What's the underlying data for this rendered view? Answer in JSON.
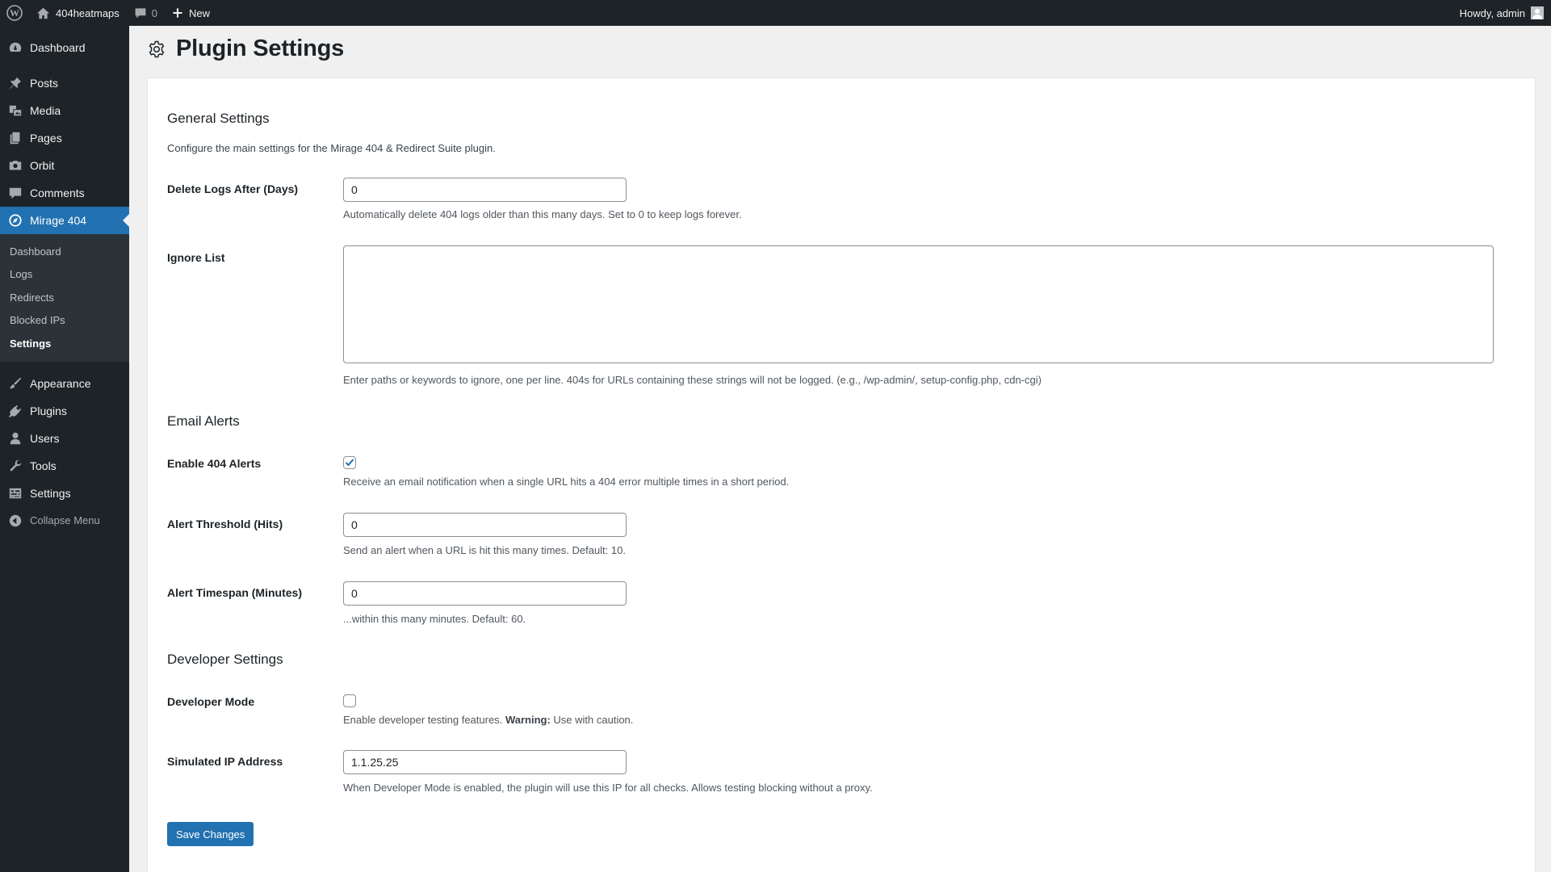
{
  "admin_bar": {
    "site_name": "404heatmaps",
    "comments_count": "0",
    "new_label": "New",
    "howdy": "Howdy, admin"
  },
  "sidebar": {
    "dashboard": "Dashboard",
    "posts": "Posts",
    "media": "Media",
    "pages": "Pages",
    "orbit": "Orbit",
    "comments": "Comments",
    "mirage": "Mirage 404",
    "submenu": [
      "Dashboard",
      "Logs",
      "Redirects",
      "Blocked IPs",
      "Settings"
    ],
    "appearance": "Appearance",
    "plugins": "Plugins",
    "users": "Users",
    "tools": "Tools",
    "settings": "Settings",
    "collapse": "Collapse Menu"
  },
  "page": {
    "title": "Plugin Settings"
  },
  "general": {
    "heading": "General Settings",
    "description": "Configure the main settings for the Mirage 404 & Redirect Suite plugin.",
    "delete_logs_label": "Delete Logs After (Days)",
    "delete_logs_value": "0",
    "delete_logs_help": "Automatically delete 404 logs older than this many days. Set to 0 to keep logs forever.",
    "ignore_list_label": "Ignore List",
    "ignore_list_value": "",
    "ignore_list_help": "Enter paths or keywords to ignore, one per line. 404s for URLs containing these strings will not be logged. (e.g., /wp-admin/, setup-config.php, cdn-cgi)"
  },
  "email": {
    "heading": "Email Alerts",
    "enable_label": "Enable 404 Alerts",
    "enable_checked": true,
    "enable_help": "Receive an email notification when a single URL hits a 404 error multiple times in a short period.",
    "threshold_label": "Alert Threshold (Hits)",
    "threshold_value": "0",
    "threshold_help": "Send an alert when a URL is hit this many times. Default: 10.",
    "timespan_label": "Alert Timespan (Minutes)",
    "timespan_value": "0",
    "timespan_help": "...within this many minutes. Default: 60."
  },
  "developer": {
    "heading": "Developer Settings",
    "mode_label": "Developer Mode",
    "mode_checked": false,
    "mode_help_prefix": "Enable developer testing features.",
    "mode_help_warning": "Warning:",
    "mode_help_suffix": "Use with caution.",
    "ip_label": "Simulated IP Address",
    "ip_value": "1.1.25.25",
    "ip_help": "When Developer Mode is enabled, the plugin will use this IP for all checks. Allows testing blocking without a proxy."
  },
  "save_label": "Save Changes",
  "colors": {
    "admin_bg": "#1d2327",
    "accent": "#2271b1",
    "page_bg": "#f0f0f1"
  }
}
